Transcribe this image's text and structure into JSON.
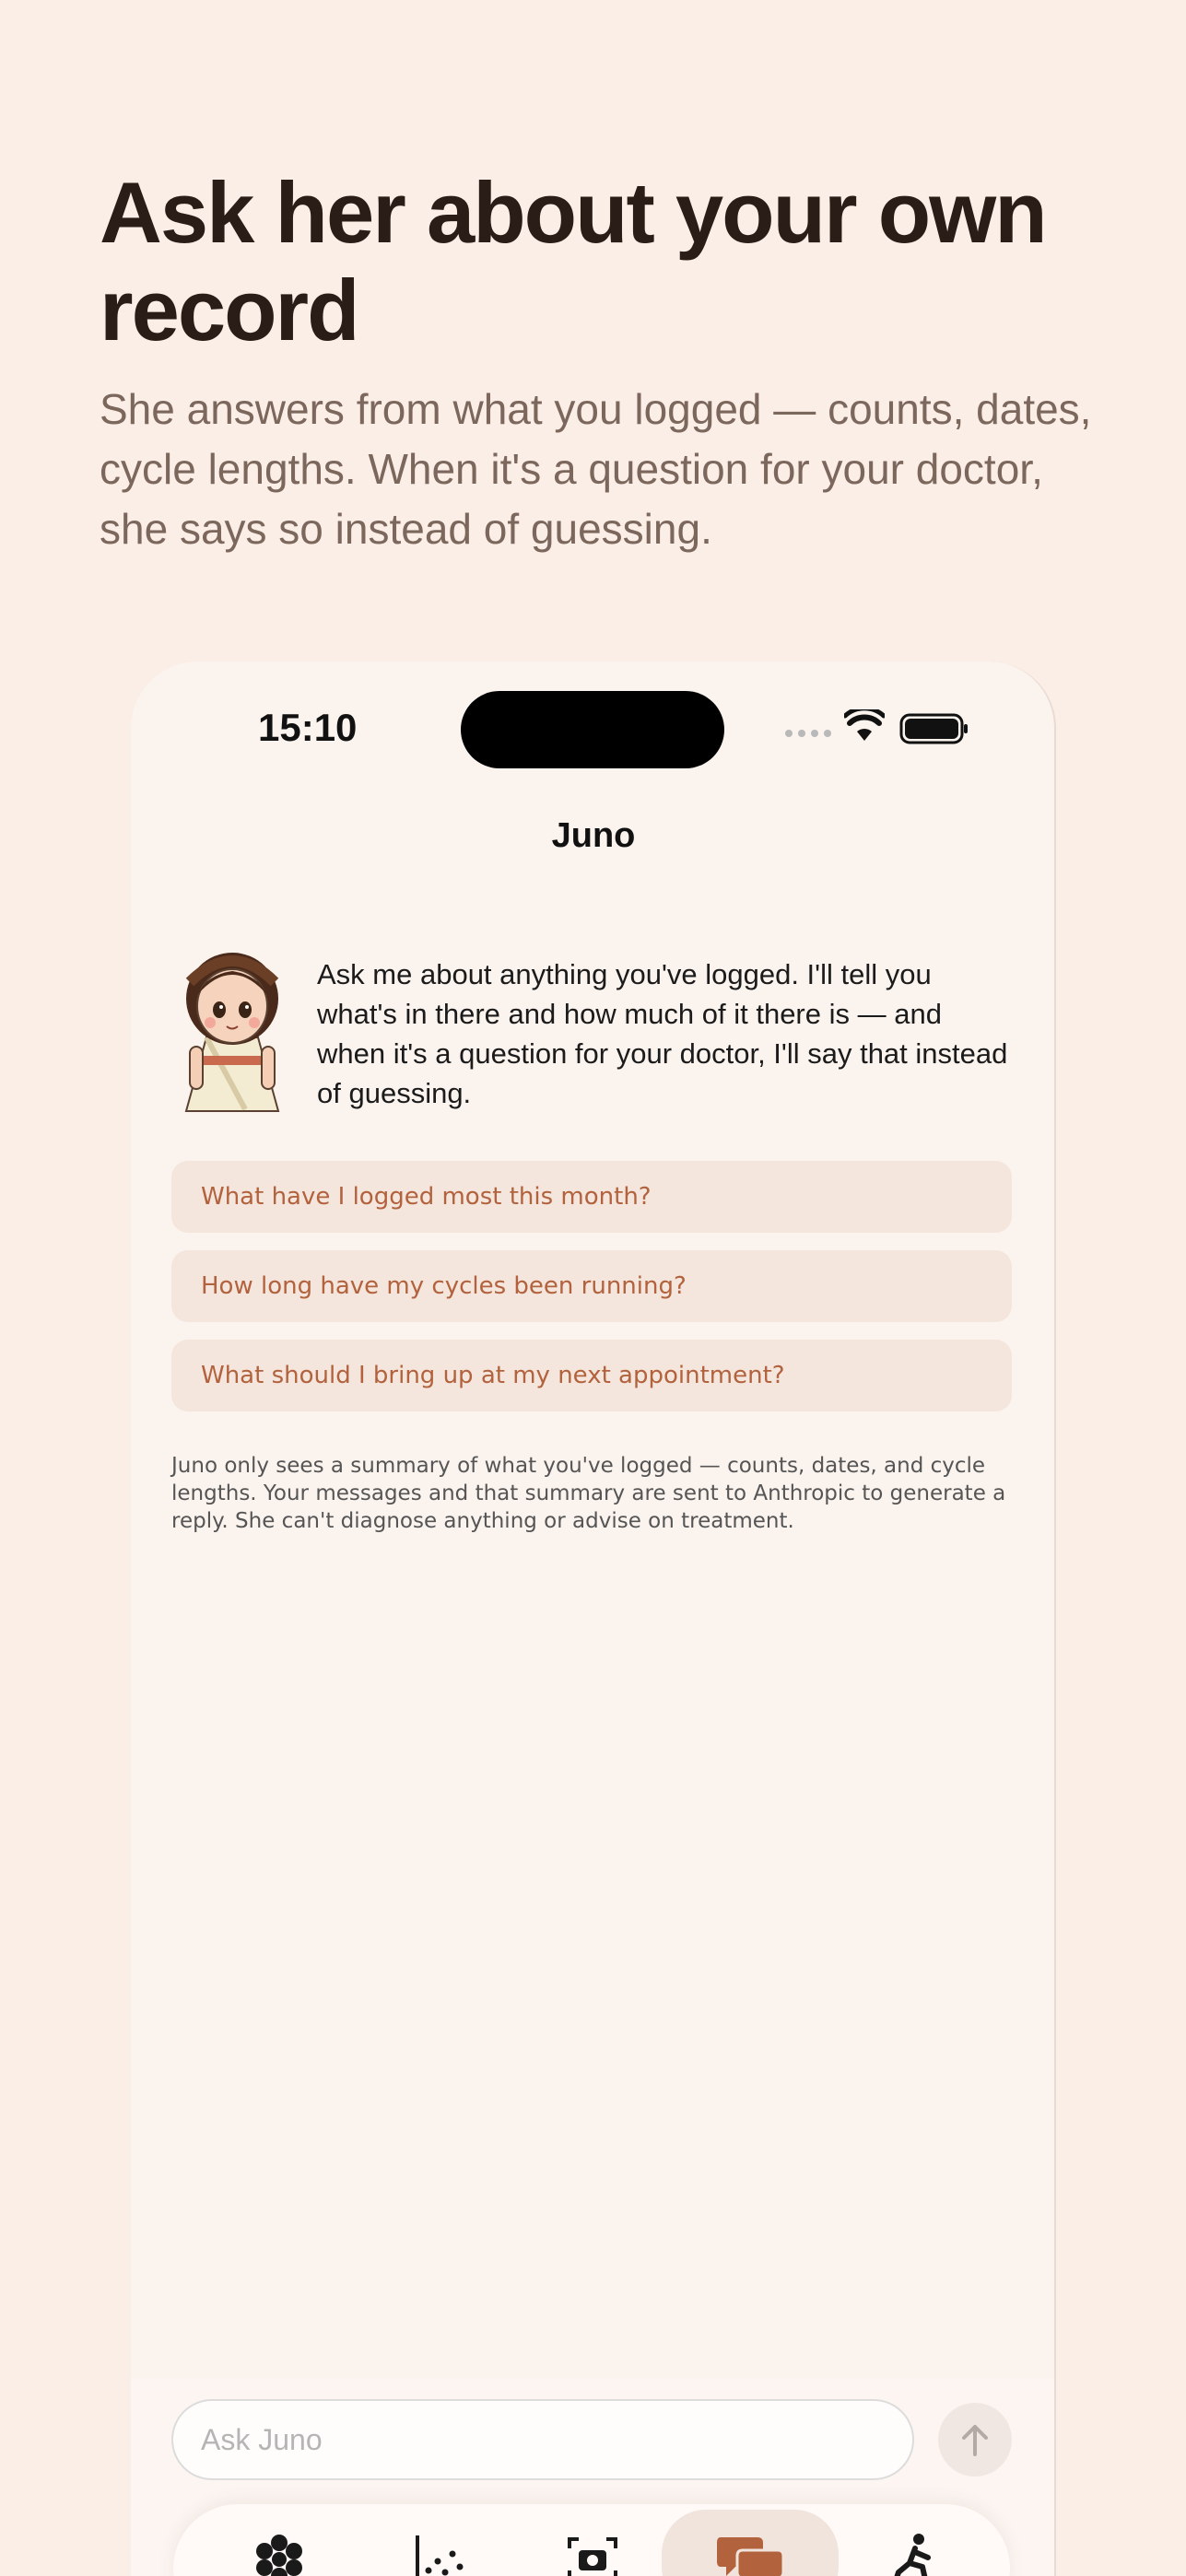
{
  "marketing": {
    "headline": "Ask her about your own record",
    "subhead": "She answers from what you logged — counts, dates, cycle lengths. When it's a question for your doctor, she says so instead of guessing."
  },
  "status_bar": {
    "time": "15:10"
  },
  "nav": {
    "title": "Juno"
  },
  "chat": {
    "intro": "Ask me about anything you've logged. I'll tell you what's in there and how much of it there is — and when it's a question for your doctor, I'll say that instead of guessing.",
    "suggestions": [
      "What have I logged most this month?",
      "How long have my cycles been running?",
      "What should I bring up at my next appointment?"
    ],
    "disclaimer": "Juno only sees a summary of what you've logged — counts, dates, and cycle lengths. Your messages and that summary are sent to Anthropic to generate a reply. She can't diagnose anything or advise on treatment."
  },
  "composer": {
    "placeholder": "Ask Juno"
  },
  "tabbar": {
    "tabs": [
      {
        "icon": "flower-icon"
      },
      {
        "icon": "scatter-chart-icon"
      },
      {
        "icon": "camera-icon"
      },
      {
        "icon": "chat-bubbles-icon",
        "active": true
      },
      {
        "icon": "exercise-icon"
      }
    ]
  },
  "colors": {
    "background": "#fbeee6",
    "accent": "#b2623c",
    "suggestion_bg": "#f4e5dd",
    "heading": "#2a1d18",
    "subhead": "#7c675d"
  }
}
